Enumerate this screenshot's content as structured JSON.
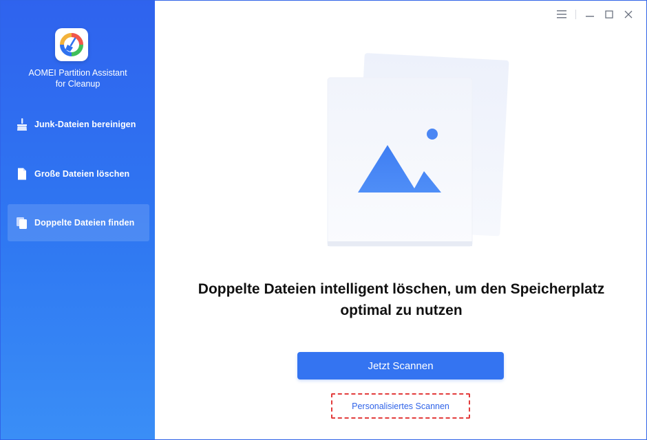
{
  "app": {
    "name_line1": "AOMEI Partition Assistant",
    "name_line2": "for Cleanup"
  },
  "sidebar": {
    "items": [
      {
        "label": "Junk-Dateien bereinigen",
        "icon": "broom-icon",
        "active": false
      },
      {
        "label": "Große Dateien löschen",
        "icon": "file-icon",
        "active": false
      },
      {
        "label": "Doppelte Dateien finden",
        "icon": "duplicate-files-icon",
        "active": true
      }
    ]
  },
  "window_controls": [
    "menu-icon",
    "minimize-icon",
    "maximize-icon",
    "close-icon"
  ],
  "main": {
    "headline_line1": "Doppelte Dateien intelligent löschen, um den Speicherplatz",
    "headline_line2": "optimal zu nutzen",
    "scan_button": "Jetzt Scannen",
    "custom_scan_link": "Personalisiertes Scannen"
  },
  "colors": {
    "sidebar": "#2f6bf0",
    "primary": "#3474f1",
    "highlight_dashed": "#e23b3b"
  }
}
